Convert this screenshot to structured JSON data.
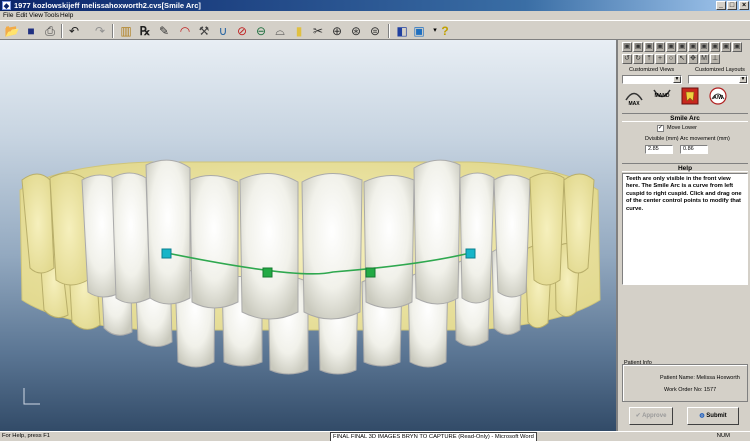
{
  "window": {
    "title": "1977 kozlowskijeff melissahoxworth2.cvs[Smile Arc]",
    "minimize": "_",
    "maximize": "□",
    "close": "×"
  },
  "menu": [
    "File",
    "Edit",
    "View",
    "Tools",
    "Help"
  ],
  "toolbar": {
    "icons": [
      "open-icon",
      "save-icon",
      "print-icon",
      "undo-icon",
      "redo-icon",
      "book-icon",
      "prescription-icon",
      "edit-icon",
      "lips-icon",
      "tooth-wand-icon",
      "arch-wire-icon",
      "rotate-icon",
      "occlusion-icon",
      "upper-arch-icon",
      "tooth-icon",
      "crossed-icon",
      "attachment-icon",
      "ruler-icon",
      "ipr-icon",
      "split-view-icon",
      "image-icon",
      "help-icon"
    ]
  },
  "panel": {
    "customized_views_label": "Customized Views",
    "customized_layouts_label": "Customized Layouts",
    "max_label": "MAX",
    "mand_label": "MAND",
    "aw_label": "A/W",
    "smile_arc": {
      "title": "Smile Arc",
      "move_lower_label": "Move Lower",
      "move_lower_checked": "✓",
      "dvisible_label": "Dvisible (mm)",
      "arc_movement_label": "Arc movement (mm)",
      "dvisible_value": "2.85",
      "arc_movement_value": "0.86"
    },
    "help": {
      "title": "Help",
      "text": "Teeth are only visible in the front view here. The Smile Arc is a curve from left cuspid to right cuspid. Click and drag one of the center control points to modify that curve."
    },
    "patient_info": {
      "title": "Patient Info",
      "patient_name": "Patient Name: Melissa Hoxworth",
      "work_order": "Work Order No: 1577"
    },
    "approve_label": "Approve",
    "submit_label": "Submit"
  },
  "status": {
    "help_text": "For Help, press F1",
    "taskbar_item": "FINAL FINAL 3D IMAGES BRYN TO CAPTURE (Read-Only) - Microsoft Word",
    "num_indicator": "NUM"
  },
  "colors": {
    "arc_line": "#2fa84f",
    "cuspid_handle": "#16b5c8",
    "center_handle": "#22aa44",
    "gum_yellow": "#f2ecb0",
    "tooth_white": "#fbfbf4"
  }
}
